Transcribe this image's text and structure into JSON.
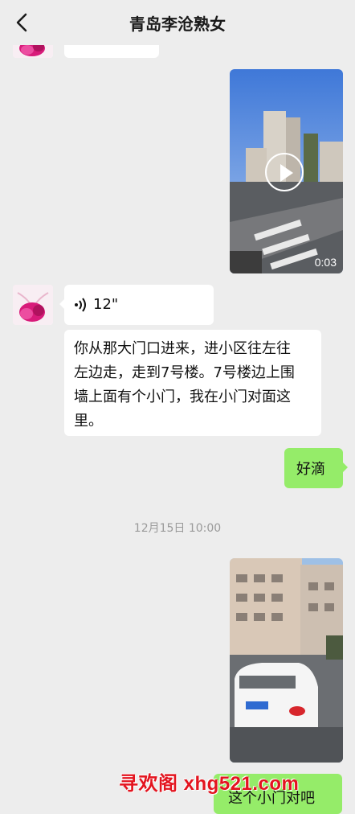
{
  "header": {
    "title": "青岛李沧熟女"
  },
  "messages": {
    "video_1_duration": "0:03",
    "voice_duration": "12\"",
    "text_reply": "你从那大门口进来，进小区往左往左边走，走到7号楼。7号楼边上围墙上面有个小门，我在小门对面这里。",
    "text_reply_lines": [
      "你从那大门口进来，进小区往左往",
      "左边走，走到7号楼。7号楼边上围",
      "墙上面有个小门，我在小门对面这",
      "里。"
    ],
    "sent_ok": "好滴",
    "timestamp": "12月15日 10:00",
    "last_partial": "这个小门对吧"
  },
  "watermark": "寻欢阁 xhg521.com",
  "colors": {
    "background": "#ededed",
    "sent_bubble": "#95ec69",
    "received_bubble": "#ffffff",
    "watermark": "#e3141f"
  }
}
